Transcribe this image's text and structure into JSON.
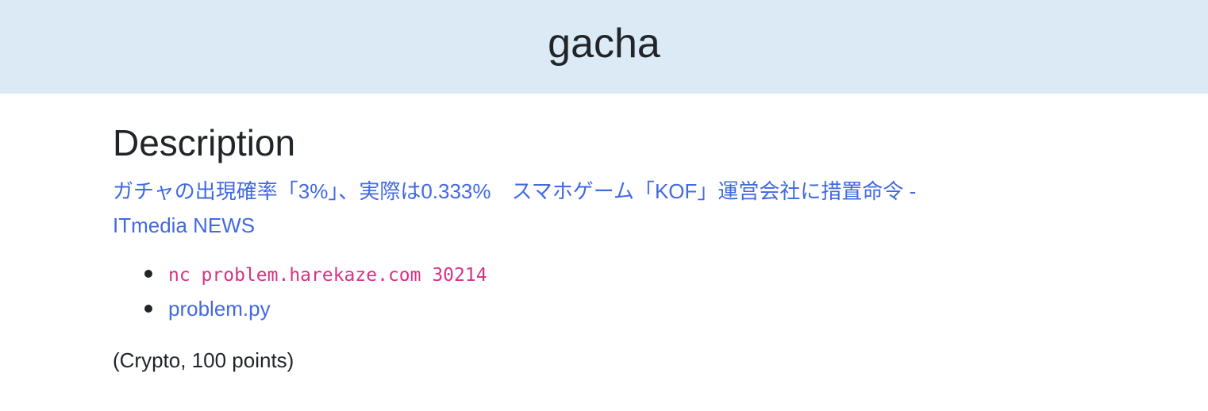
{
  "header": {
    "title": "gacha"
  },
  "section": {
    "heading": "Description",
    "article_link_line1": "ガチャの出現確率「3%」、実際は0.333%　スマホゲーム「KOF」運営会社に措置命令 -",
    "article_link_line2": "ITmedia NEWS"
  },
  "links": {
    "command": "nc problem.harekaze.com 30214",
    "file": "problem.py"
  },
  "category": "(Crypto, 100 points)",
  "colors": {
    "header_bg": "#dbeaf5",
    "link": "#4169e1",
    "code": "#d63384",
    "text": "#212529"
  }
}
